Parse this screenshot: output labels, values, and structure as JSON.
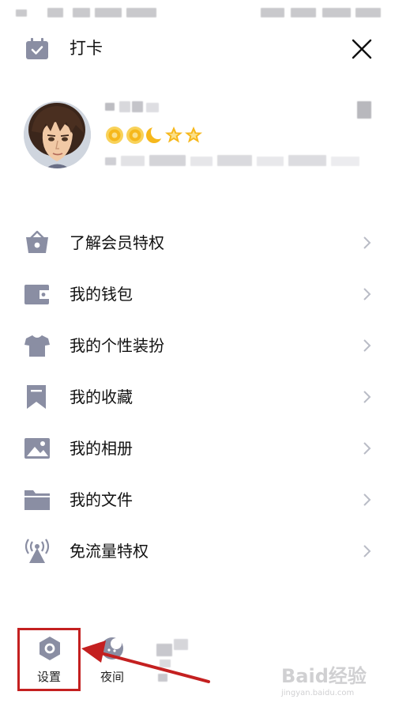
{
  "header": {
    "checkin_label": "打卡"
  },
  "icons": {
    "checkin": "calendar-check-icon",
    "close": "close-icon",
    "chevron": "chevron-right-icon",
    "settings": "hexagon-gear-icon",
    "night": "moon-face-icon"
  },
  "profile": {
    "level_badges": [
      "sun",
      "sun",
      "moon",
      "star",
      "star"
    ]
  },
  "menu": {
    "items": [
      {
        "label": "了解会员特权",
        "icon": "crown-basket-icon"
      },
      {
        "label": "我的钱包",
        "icon": "wallet-icon"
      },
      {
        "label": "我的个性装扮",
        "icon": "tshirt-icon"
      },
      {
        "label": "我的收藏",
        "icon": "bookmark-icon"
      },
      {
        "label": "我的相册",
        "icon": "photo-icon"
      },
      {
        "label": "我的文件",
        "icon": "folder-icon"
      },
      {
        "label": "免流量特权",
        "icon": "signal-tower-icon"
      }
    ]
  },
  "bottom_bar": {
    "settings_label": "设置",
    "night_label": "夜间"
  },
  "watermark": {
    "main": "Baid经验",
    "sub": "jingyan.baidu.com"
  },
  "colors": {
    "icon_gray": "#8a8ea3",
    "chevron_gray": "#b9bcc6",
    "annotation_red": "#c42020",
    "badge_gold": "#f6b81c"
  }
}
